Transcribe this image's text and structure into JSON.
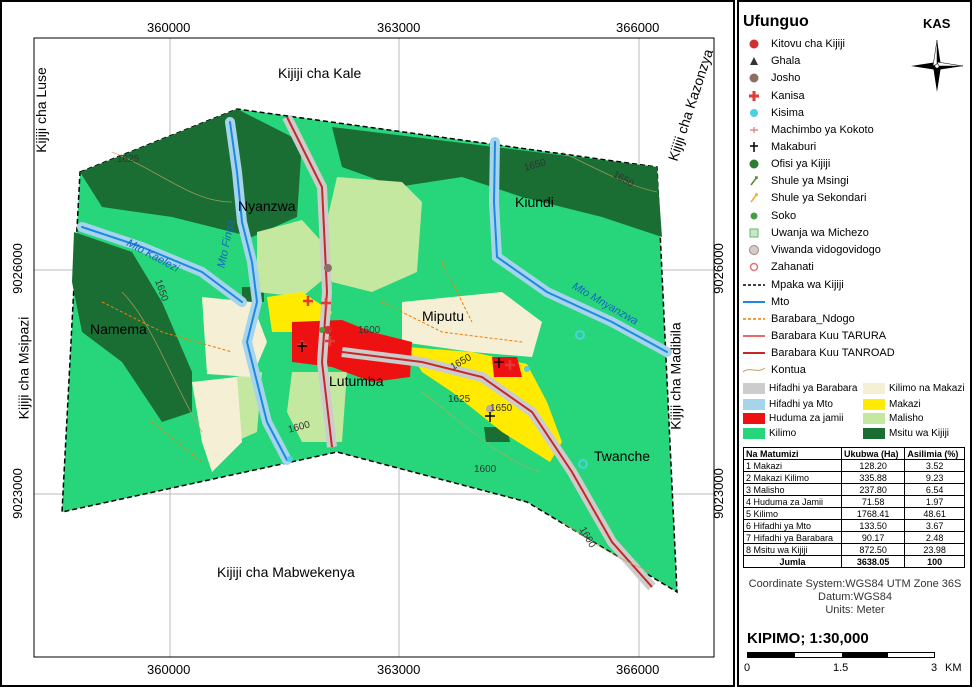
{
  "map": {
    "top_ticks": [
      "360000",
      "363000",
      "366000"
    ],
    "bottom_ticks": [
      "360000",
      "363000",
      "366000"
    ],
    "left_ticks": [
      "9026000",
      "9023000"
    ],
    "right_ticks": [
      "9026000",
      "9023000"
    ],
    "neighbors": {
      "north": "Kijiji cha Kale",
      "south": "Kijiji cha Mabwekenya",
      "west": "Kijiji cha Msipazi",
      "east": "Kijiji cha Madibila",
      "northwest": "Kijiji cha Luse",
      "northeast": "Kijiji cha Kazonzya"
    },
    "places": [
      "Nyanzwa",
      "Kiundi",
      "Miputu",
      "Namema",
      "Lutumba",
      "Twanche"
    ],
    "rivers": [
      "Mto Kaelezi",
      "Mto Finga",
      "Mto Mnyanzwa"
    ],
    "contours": [
      "1625",
      "1650",
      "1650",
      "1650",
      "1600",
      "1625",
      "1650",
      "1600",
      "1600",
      "1600",
      "1650"
    ]
  },
  "legend": {
    "title": "Ufunguo",
    "kas": "KAS",
    "points": [
      {
        "label": "Kitovu cha Kijiji",
        "icon": "village-center-icon",
        "color": "#d32f2f"
      },
      {
        "label": "Ghala",
        "icon": "warehouse-icon",
        "color": "#333333"
      },
      {
        "label": "Josho",
        "icon": "cattle-dip-icon",
        "color": "#8d6e63"
      },
      {
        "label": "Kanisa",
        "icon": "church-icon",
        "color": "#e53935"
      },
      {
        "label": "Kisima",
        "icon": "well-icon",
        "color": "#4dd0e1"
      },
      {
        "label": "Machimbo ya Kokoto",
        "icon": "quarry-icon",
        "color": "#e57373"
      },
      {
        "label": "Makaburi",
        "icon": "cemetery-icon",
        "color": "#000000"
      },
      {
        "label": "Ofisi ya Kijiji",
        "icon": "office-icon",
        "color": "#2e7d32"
      },
      {
        "label": "Shule ya Msingi",
        "icon": "primary-school-icon",
        "color": "#558b2f"
      },
      {
        "label": "Shule ya Sekondari",
        "icon": "secondary-school-icon",
        "color": "#f9a825"
      },
      {
        "label": "Soko",
        "icon": "market-icon",
        "color": "#43a047"
      },
      {
        "label": "Uwanja wa Michezo",
        "icon": "playground-icon",
        "color": "#66bb6a"
      },
      {
        "label": "Viwanda vidogovidogo",
        "icon": "small-industry-icon",
        "color": "#bcaaa4"
      },
      {
        "label": "Zahanati",
        "icon": "dispensary-icon",
        "color": "#e57373"
      }
    ],
    "lines": [
      {
        "label": "Mpaka wa Kijiji",
        "icon": "boundary-line-icon",
        "color": "#000000"
      },
      {
        "label": "Mto",
        "icon": "river-line-icon",
        "color": "#1e88e5"
      },
      {
        "label": "Barabara_Ndogo",
        "icon": "minor-road-icon",
        "color": "#f57c00"
      },
      {
        "label": "Barabara Kuu TARURA",
        "icon": "tarura-road-icon",
        "color": "#e53935"
      },
      {
        "label": "Barabara Kuu TANROAD",
        "icon": "tanroad-road-icon",
        "color": "#c62828"
      },
      {
        "label": "Kontua",
        "icon": "contour-line-icon",
        "color": "#c0a060"
      }
    ],
    "areas_left": [
      {
        "label": "Hifadhi ya Barabara",
        "color": "#cccccc"
      },
      {
        "label": "Hifadhi ya Mto",
        "color": "#a6d4ea"
      },
      {
        "label": "Huduma za jamii",
        "color": "#ee1111"
      },
      {
        "label": "Kilimo",
        "color": "#27d67b"
      }
    ],
    "areas_right": [
      {
        "label": "Kilimo na Makazi",
        "color": "#f5efd6"
      },
      {
        "label": "Makazi",
        "color": "#ffea00"
      },
      {
        "label": "Malisho",
        "color": "#c5e8a0"
      },
      {
        "label": "Msitu wa Kijiji",
        "color": "#1a6e34"
      }
    ],
    "table": {
      "headers": [
        "Na Matumizi",
        "Ukubwa (Ha)",
        "Asilimia (%)"
      ],
      "rows": [
        [
          "1 Makazi",
          "128.20",
          "3.52"
        ],
        [
          "2 Makazi Kilimo",
          "335.88",
          "9.23"
        ],
        [
          "3 Malisho",
          "237.80",
          "6.54"
        ],
        [
          "4 Huduma za Jamii",
          "71.58",
          "1.97"
        ],
        [
          "5 Kilimo",
          "1768.41",
          "48.61"
        ],
        [
          "6 Hifadhi ya Mto",
          "133.50",
          "3.67"
        ],
        [
          "7 Hifadhi ya Barabara",
          "90.17",
          "2.48"
        ],
        [
          "8 Msitu wa Kijiji",
          "872.50",
          "23.98"
        ]
      ],
      "total": [
        "Jumla",
        "3638.05",
        "100"
      ]
    },
    "datum": [
      "Coordinate System:WGS84 UTM Zone 36S",
      "Datum:WGS84",
      "Units: Meter"
    ],
    "scale": {
      "title": "KIPIMO; 1:30,000",
      "ticks": [
        "0",
        "1.5",
        "3",
        "KM"
      ]
    }
  }
}
